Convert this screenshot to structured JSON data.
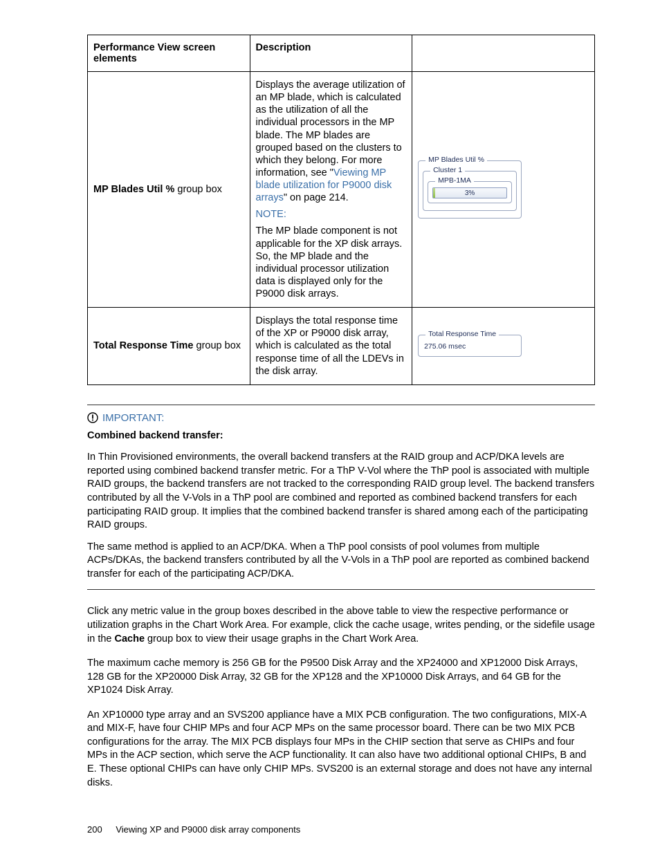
{
  "table": {
    "headers": {
      "col1": "Performance View screen elements",
      "col2": "Description"
    },
    "row1": {
      "label_prefix": "MP Blades Util % ",
      "label_suffix": "group box",
      "desc_p1_a": "Displays the average utilization of an MP blade, which is calculated as the utilization of all the individual processors in the MP blade. The MP blades are grouped based on the clusters to which they belong. For more information, see \"",
      "desc_link": "Viewing MP blade utilization for P9000 disk arrays",
      "desc_p1_b": "\" on page 214.",
      "note_label": "NOTE:",
      "desc_p2": "The MP blade component is not applicable for the XP disk arrays. So, the MP blade and the individual processor utilization data is displayed only for the P9000 disk arrays.",
      "groupbox": {
        "outer_title": "MP Blades Util %",
        "cluster_title": "Cluster 1",
        "mpb_title": "MPB-1MA",
        "percent": "3%"
      }
    },
    "row2": {
      "label_prefix": "Total Response Time ",
      "label_suffix": "group box",
      "desc": "Displays the total response time of the XP or P9000 disk array, which is calculated as the total response time of all the LDEVs in the disk array.",
      "groupbox": {
        "title": "Total Response Time",
        "value": "275.06 msec"
      }
    }
  },
  "important": {
    "label": "IMPORTANT:",
    "subhead": "Combined backend transfer",
    "p1": "In Thin Provisioned environments, the overall backend transfers at the RAID group and ACP/DKA levels are reported using combined backend transfer metric. For a ThP V-Vol where the ThP pool is associated with multiple RAID groups, the backend transfers are not tracked to the corresponding RAID group level. The backend transfers contributed by all the V-Vols in a ThP pool are combined and reported as combined backend transfers for each participating RAID group. It implies that the combined backend transfer is shared among each of the participating RAID groups.",
    "p2": "The same method is applied to an ACP/DKA. When a ThP pool consists of pool volumes from multiple ACPs/DKAs, the backend transfers contributed by all the V-Vols in a ThP pool are reported as combined backend transfer for each of the participating ACP/DKA."
  },
  "body": {
    "p1_a": "Click any metric value in the group boxes described in the above table to view the respective performance or utilization graphs in the Chart Work Area. For example, click the cache usage, writes pending, or the sidefile usage in the ",
    "p1_bold": "Cache",
    "p1_b": " group box to view their usage graphs in the Chart Work Area.",
    "p2": "The maximum cache memory is 256 GB for the P9500 Disk Array and the XP24000 and XP12000 Disk Arrays, 128 GB for the XP20000 Disk Array, 32 GB for the XP128 and the XP10000 Disk Arrays, and 64 GB for the XP1024 Disk Array.",
    "p3": "An XP10000 type array and an SVS200 appliance have a MIX PCB configuration. The two configurations, MIX-A and MIX-F, have four CHIP MPs and four ACP MPs on the same processor board. There can be two MIX PCB configurations for the array. The MIX PCB displays four MPs in the CHIP section that serve as CHIPs and four MPs in the ACP section, which serve the ACP functionality. It can also have two additional optional CHIPs, B and E. These optional CHIPs can have only CHIP MPs. SVS200 is an external storage and does not have any internal disks."
  },
  "footer": {
    "page": "200",
    "chapter": "Viewing XP and P9000 disk array components"
  }
}
